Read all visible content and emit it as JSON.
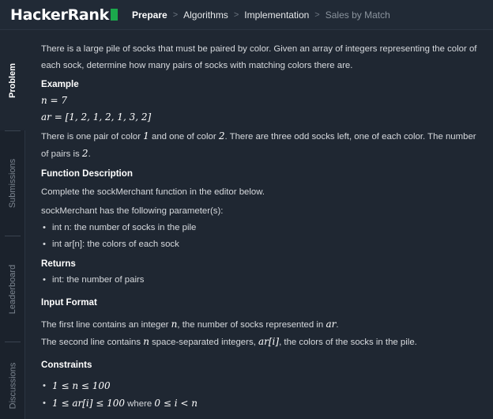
{
  "header": {
    "logo_text": "HackerRank",
    "breadcrumbs": [
      "Prepare",
      "Algorithms",
      "Implementation",
      "Sales by Match"
    ],
    "brand_color": "#1ba94c"
  },
  "sidebar": {
    "tabs": [
      "Problem",
      "Submissions",
      "Leaderboard",
      "Discussions"
    ],
    "active": "Problem"
  },
  "problem": {
    "intro": "There is a large pile of socks that must be paired by color. Given an array of integers representing the color of each sock, determine how many pairs of socks with matching colors there are.",
    "example_heading": "Example",
    "example_n": "n = 7",
    "example_ar": "ar = [1, 2, 1, 2, 1, 3, 2]",
    "explain_1": "There is one pair of color",
    "explain_c1": "1",
    "explain_2": "and one of color",
    "explain_c2": "2",
    "explain_3": ". There are three odd socks left, one of each color. The number of pairs is",
    "explain_val": "2",
    "explain_4": ".",
    "fd_heading": "Function Description",
    "fd_text": "Complete the sockMerchant function in the editor below.",
    "params_intro": "sockMerchant has the following parameter(s):",
    "params": [
      "int n: the number of socks in the pile",
      "int ar[n]: the colors of each sock"
    ],
    "returns_heading": "Returns",
    "returns": [
      "int: the number of pairs"
    ],
    "input_heading": "Input Format",
    "input_line1_a": "The first line contains an integer",
    "input_line1_var": "n",
    "input_line1_b": ", the number of socks represented in",
    "input_line1_var2": "ar",
    "input_line1_c": ".",
    "input_line2_a": "The second line contains",
    "input_line2_var": "n",
    "input_line2_b": "space-separated integers,",
    "input_line2_var2": "ar[i]",
    "input_line2_c": ", the colors of the socks in the pile.",
    "constraints_heading": "Constraints",
    "constraint_1": "1 ≤ n ≤ 100",
    "constraint_2_math": "1 ≤ ar[i] ≤ 100",
    "constraint_2_where": "where",
    "constraint_2_math2": "0 ≤ i < n"
  }
}
